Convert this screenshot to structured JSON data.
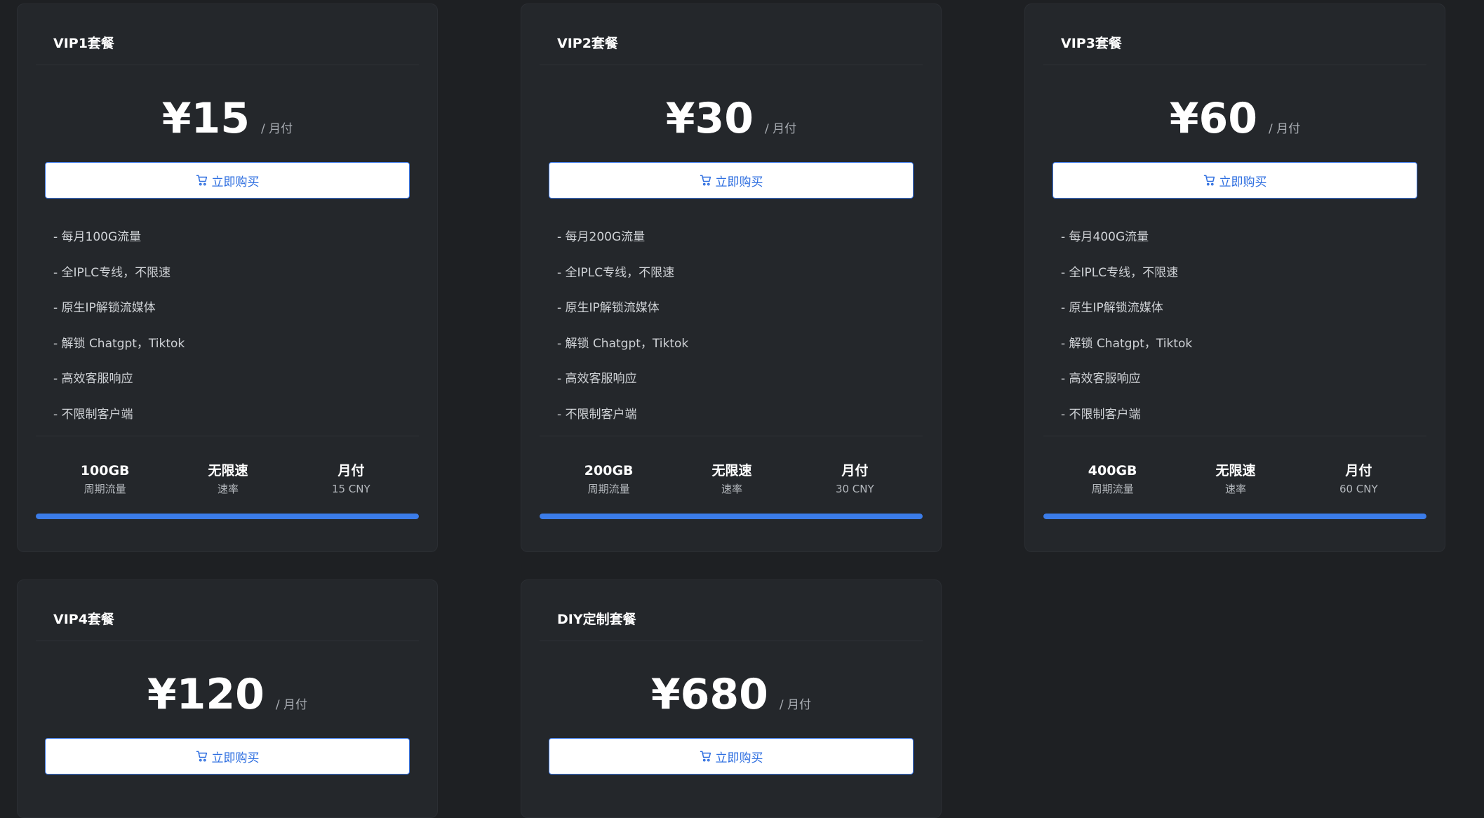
{
  "plans": [
    {
      "title": "VIP1套餐",
      "price": "¥15",
      "period": "/ 月付",
      "buy_label": "立即购买",
      "features": [
        "- 每月100G流量",
        "- 全IPLC专线，不限速",
        "- 原生IP解锁流媒体",
        "- 解锁 Chatgpt，Tiktok",
        "- 高效客服响应",
        "- 不限制客户端"
      ],
      "stats": [
        {
          "value": "100GB",
          "label": "周期流量"
        },
        {
          "value": "无限速",
          "label": "速率"
        },
        {
          "value": "月付",
          "label": "15 CNY"
        }
      ],
      "progress": 1.0
    },
    {
      "title": "VIP2套餐",
      "price": "¥30",
      "period": "/ 月付",
      "buy_label": "立即购买",
      "features": [
        "- 每月200G流量",
        "- 全IPLC专线，不限速",
        "- 原生IP解锁流媒体",
        "- 解锁 Chatgpt，Tiktok",
        "- 高效客服响应",
        "- 不限制客户端"
      ],
      "stats": [
        {
          "value": "200GB",
          "label": "周期流量"
        },
        {
          "value": "无限速",
          "label": "速率"
        },
        {
          "value": "月付",
          "label": "30 CNY"
        }
      ],
      "progress": 1.0
    },
    {
      "title": "VIP3套餐",
      "price": "¥60",
      "period": "/ 月付",
      "buy_label": "立即购买",
      "features": [
        "- 每月400G流量",
        "- 全IPLC专线，不限速",
        "- 原生IP解锁流媒体",
        "- 解锁 Chatgpt，Tiktok",
        "- 高效客服响应",
        "- 不限制客户端"
      ],
      "stats": [
        {
          "value": "400GB",
          "label": "周期流量"
        },
        {
          "value": "无限速",
          "label": "速率"
        },
        {
          "value": "月付",
          "label": "60 CNY"
        }
      ],
      "progress": 1.0
    },
    {
      "title": "VIP4套餐",
      "price": "¥120",
      "period": "/ 月付",
      "buy_label": "立即购买"
    },
    {
      "title": "DIY定制套餐",
      "price": "¥680",
      "period": "/ 月付",
      "buy_label": "立即购买"
    }
  ],
  "icons": {
    "cart": "shopping-cart-icon"
  },
  "colors": {
    "accent": "#3b7ce9",
    "card_bg": "#24272b",
    "page_bg": "#1e2023"
  }
}
